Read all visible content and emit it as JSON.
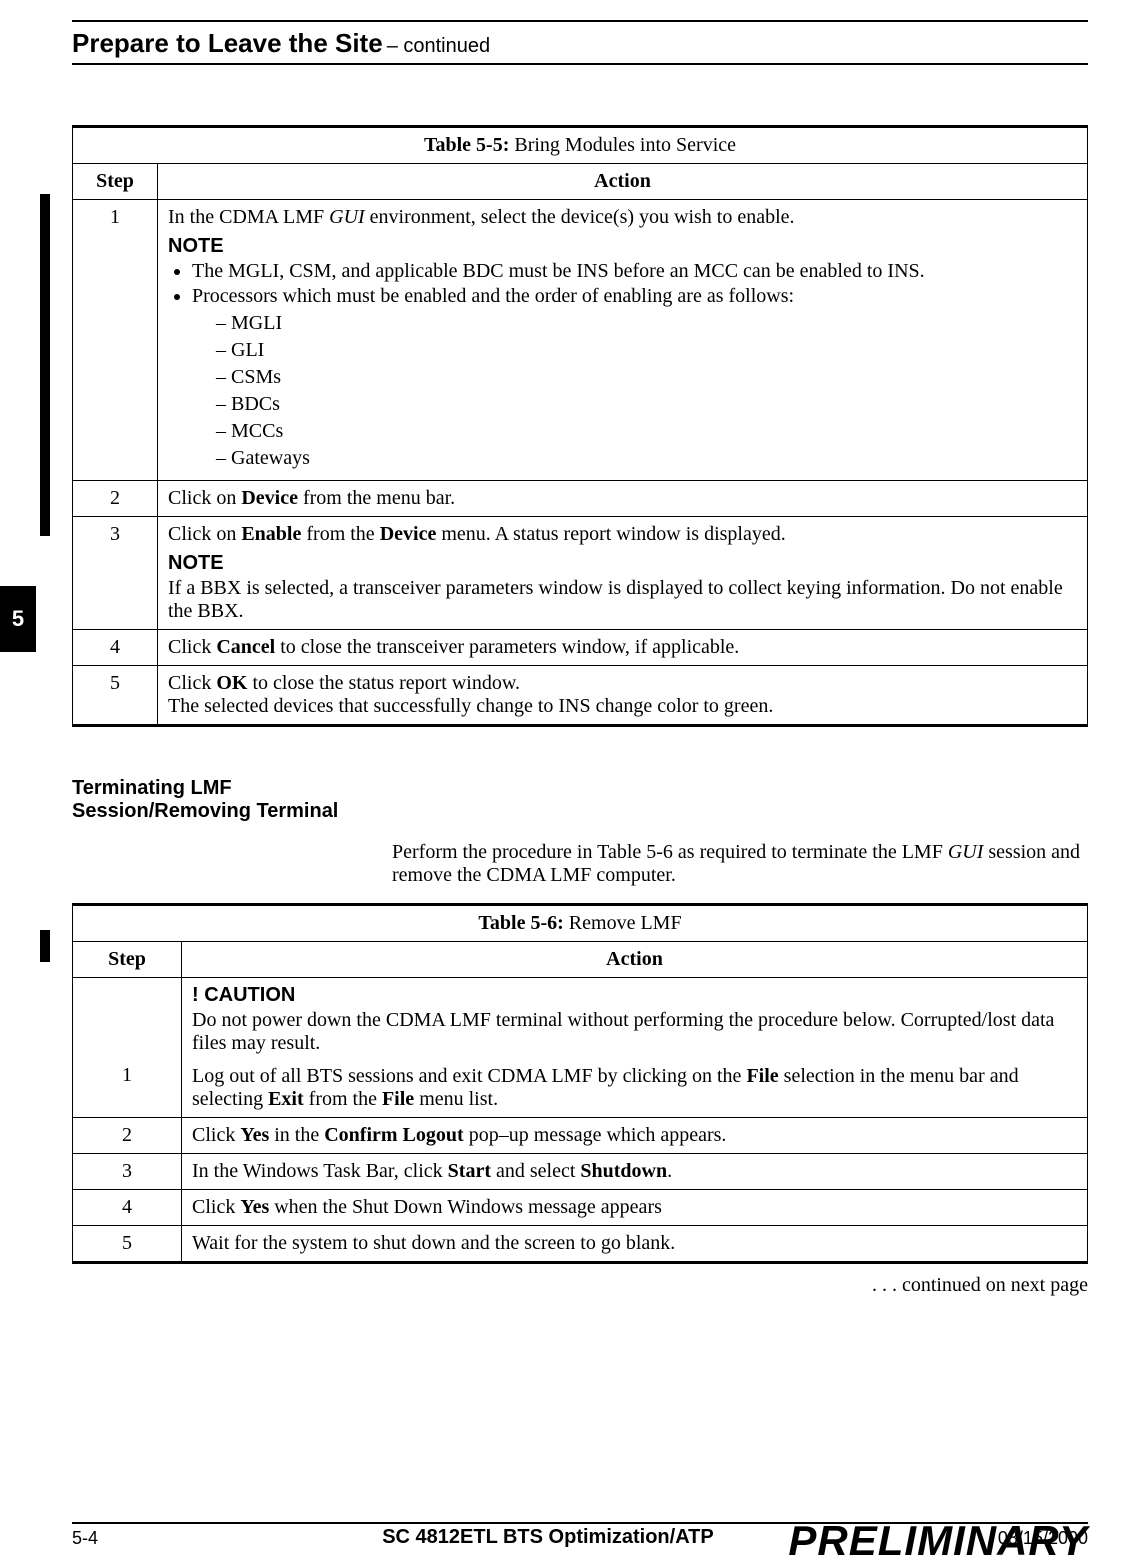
{
  "header": {
    "title": "Prepare to Leave the Site",
    "continued": "  – continued"
  },
  "chapterTab": "5",
  "table55": {
    "caption_label": "Table 5-5:",
    "caption_rest": " Bring Modules into Service",
    "head_step": "Step",
    "head_action": "Action",
    "r1": {
      "step": "1",
      "line1a": "In the CDMA LMF ",
      "line1b": "GUI",
      "line1c": " environment, select the device(s) you wish to enable.",
      "note": "NOTE",
      "b1": "The MGLI, CSM, and applicable BDC must be INS before an MCC can be enabled to INS.",
      "b2": "Processors which must be enabled and the order of enabling are as follows:",
      "d1": "MGLI",
      "d2": "GLI",
      "d3": "CSMs",
      "d4": "BDCs",
      "d5": "MCCs",
      "d6": "Gateways"
    },
    "r2": {
      "step": "2",
      "a1": "Click on ",
      "a2": "Device",
      "a3": " from the menu bar."
    },
    "r3": {
      "step": "3",
      "a1": "Click on ",
      "a2": "Enable",
      "a3": " from the ",
      "a4": "Device",
      "a5": " menu. A status report window is displayed.",
      "note": "NOTE",
      "body": "If a BBX is selected, a transceiver parameters window is displayed to collect keying information. Do not enable the BBX."
    },
    "r4": {
      "step": "4",
      "a1": "Click ",
      "a2": "Cancel",
      "a3": " to close the transceiver parameters window, if applicable."
    },
    "r5": {
      "step": "5",
      "a1": "Click ",
      "a2": "OK",
      "a3": " to close the status report window.",
      "l2": "The selected devices that successfully change to INS change color to green."
    }
  },
  "section2": {
    "heading_l1": "Terminating LMF",
    "heading_l2": "Session/Removing Terminal",
    "para_a": "Perform the procedure in Table 5-6 as required to terminate the LMF ",
    "para_b": "GUI",
    "para_c": " session and remove the CDMA LMF computer."
  },
  "table56": {
    "caption_label": "Table 5-6:",
    "caption_rest": " Remove LMF",
    "head_step": "Step",
    "head_action": "Action",
    "r1": {
      "caution": "! CAUTION",
      "caution_body": "Do not power down the CDMA LMF terminal without performing the procedure below. Corrupted/lost data files may result.",
      "step": "1",
      "a1": "Log out of all BTS sessions and exit CDMA LMF by clicking on the ",
      "a2": "File",
      "a3": " selection in the menu bar and selecting ",
      "a4": "Exit",
      "a5": " from the ",
      "a6": "File",
      "a7": " menu list."
    },
    "r2": {
      "step": "2",
      "a1": "Click ",
      "a2": "Yes",
      "a3": " in the ",
      "a4": "Confirm Logout",
      "a5": " pop–up message which appears."
    },
    "r3": {
      "step": "3",
      "a1": "In the Windows Task Bar, click ",
      "a2": "Start",
      "a3": " and select ",
      "a4": "Shutdown",
      "a5": "."
    },
    "r4": {
      "step": "4",
      "a1": "Click ",
      "a2": "Yes",
      "a3": " when the Shut Down Windows message appears"
    },
    "r5": {
      "step": "5",
      "a1": "Wait for the system to shut down and the screen to go blank."
    }
  },
  "continuedNote": ". . . continued on next page",
  "footer": {
    "left": "5-4",
    "center": "SC 4812ETL BTS Optimization/ATP",
    "right": "08/15/2000",
    "prelim": "PRELIMINARY"
  }
}
